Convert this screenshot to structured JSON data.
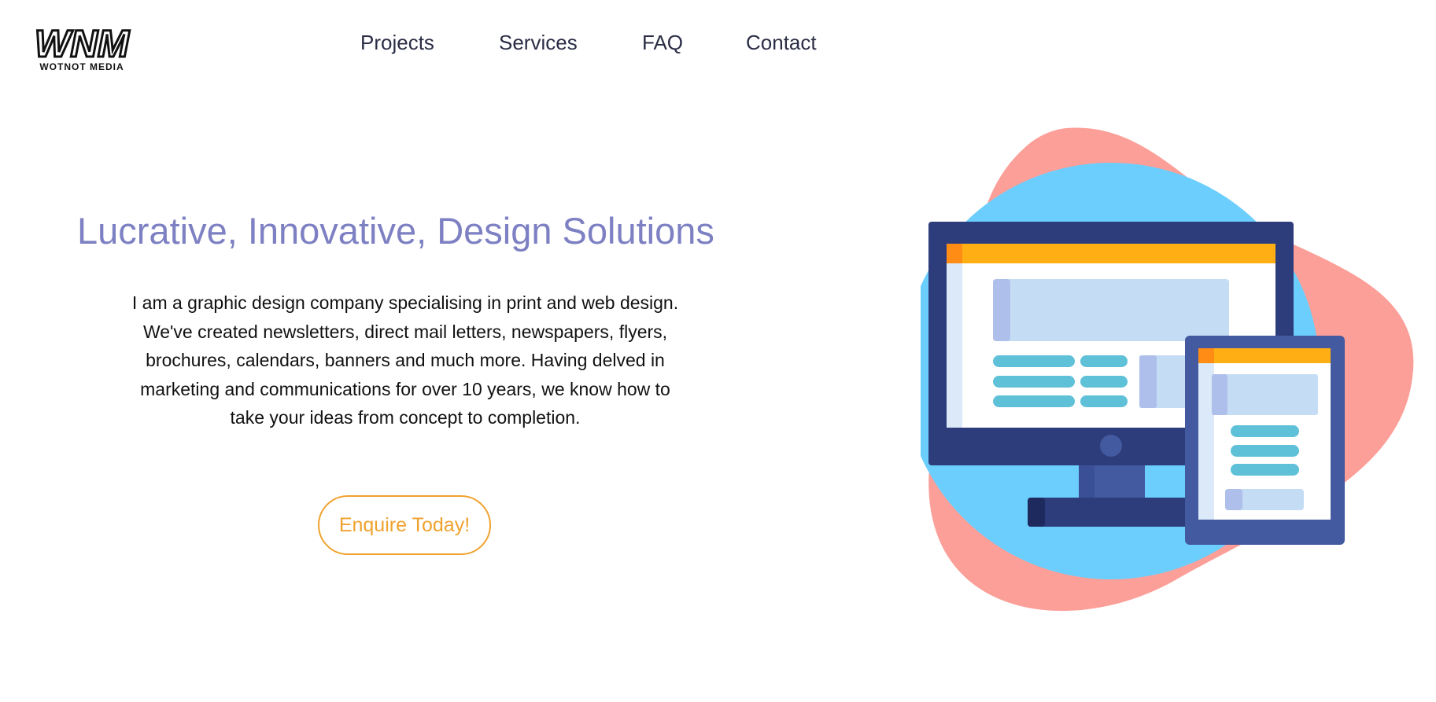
{
  "brand": {
    "logo_mark": "WNM",
    "logo_sub": "WOTNOT MEDIA"
  },
  "nav": {
    "items": [
      {
        "label": "Projects"
      },
      {
        "label": "Services"
      },
      {
        "label": "FAQ"
      },
      {
        "label": "Contact"
      }
    ]
  },
  "hero": {
    "title": "Lucrative, Innovative, Design Solutions",
    "body": "I am a graphic design company specialising in print and web design. We've created newsletters, direct mail letters, newspapers, flyers, brochures, calendars, banners and much more. Having delved in marketing and communications for over 10 years, we know how to take your ideas from concept to completion.",
    "cta_label": "Enquire Today!"
  },
  "colors": {
    "title": "#7d80c2",
    "accent": "#f0a22e",
    "nav_text": "#2a2d45",
    "blob_pink": "#fc9f98",
    "blob_blue": "#6ccefd",
    "device_navy": "#2d3d7c"
  },
  "icons": {
    "illustration": "desktop-and-tablet-illustration"
  }
}
